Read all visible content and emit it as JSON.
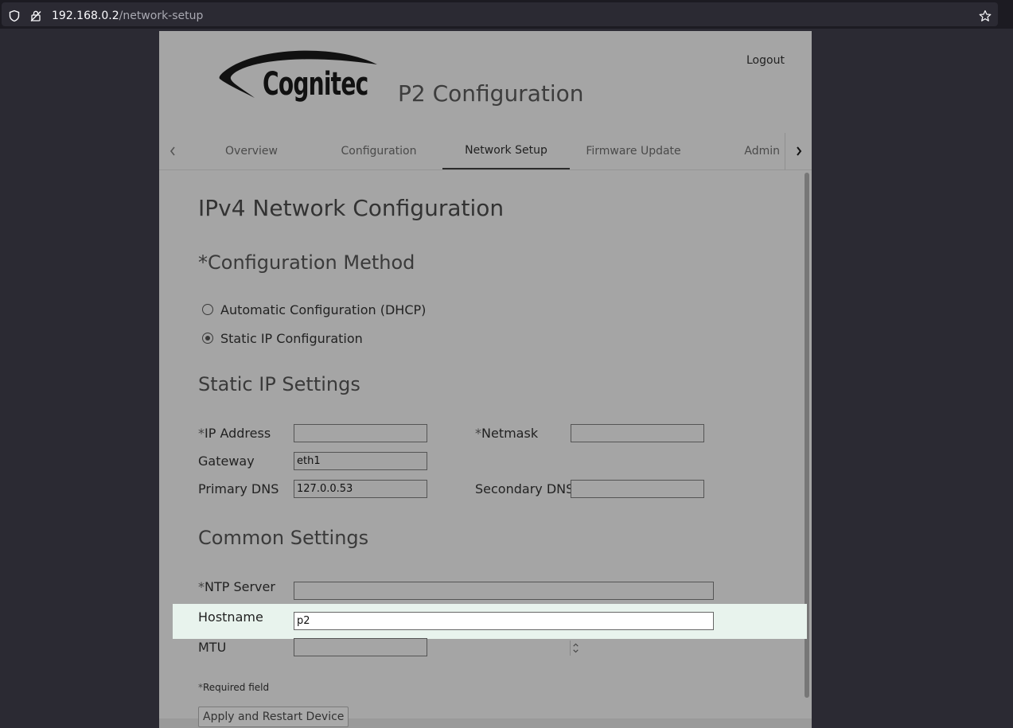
{
  "browser": {
    "url_host": "192.168.0.2",
    "url_path": "/network-setup"
  },
  "header": {
    "logo_text": "Cognitec",
    "title": "P2 Configuration",
    "logout_label": "Logout"
  },
  "tabs": [
    {
      "label": "Overview"
    },
    {
      "label": "Configuration"
    },
    {
      "label": "Network Setup",
      "active": true
    },
    {
      "label": "Firmware Update"
    },
    {
      "label": "Admin"
    }
  ],
  "main": {
    "title": "IPv4 Network Configuration",
    "method": {
      "heading": "*Configuration Method",
      "options": [
        {
          "label": "Automatic Configuration (DHCP)",
          "selected": false
        },
        {
          "label": "Static IP Configuration",
          "selected": true
        }
      ]
    },
    "static": {
      "heading": "Static IP Settings",
      "ip_label_star": "*",
      "ip_label": "IP Address",
      "ip_value": "",
      "netmask_label_star": "*",
      "netmask_label": "Netmask",
      "netmask_value": "",
      "gateway_label": "Gateway",
      "gateway_value": "eth1",
      "primary_dns_label": "Primary DNS",
      "primary_dns_value": "127.0.0.53",
      "secondary_dns_label": "Secondary DNS",
      "secondary_dns_value": ""
    },
    "common": {
      "heading": "Common Settings",
      "ntp_label_star": "*",
      "ntp_label": "NTP Server",
      "ntp_value": "",
      "hostname_label": "Hostname",
      "hostname_value": "p2",
      "mtu_label": "MTU",
      "mtu_value": ""
    },
    "required_star": "*",
    "required_note": "Required field",
    "apply_label": "Apply and Restart Device"
  }
}
